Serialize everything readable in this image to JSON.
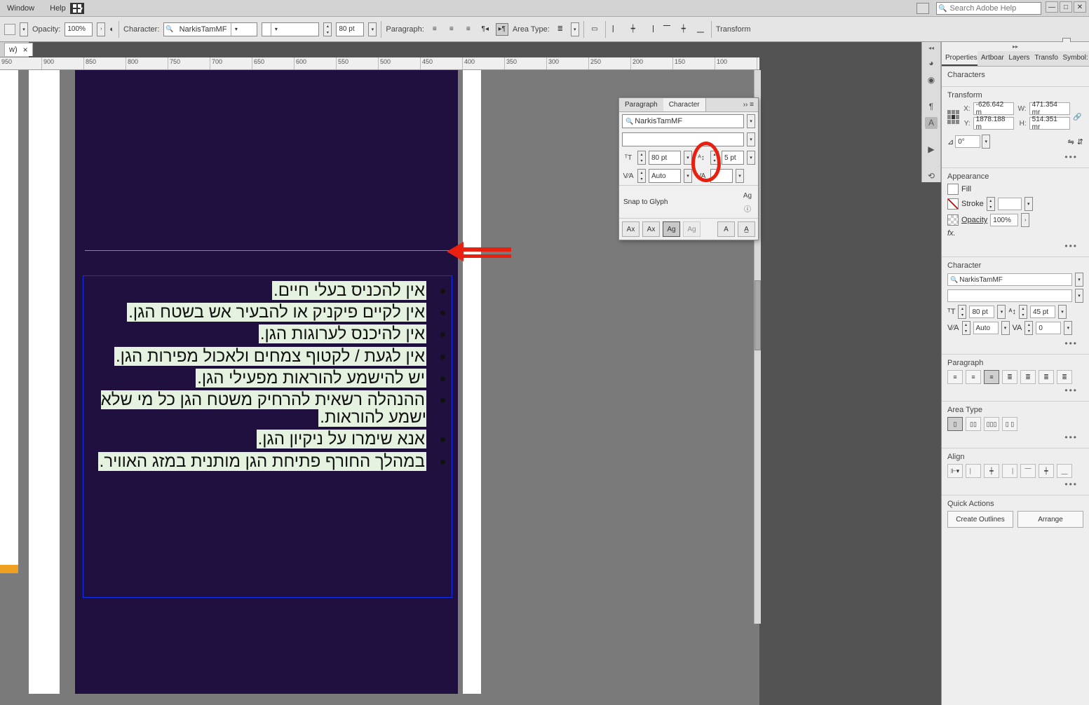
{
  "menubar": {
    "window": "Window",
    "help": "Help"
  },
  "search": {
    "placeholder": "Search Adobe Help"
  },
  "controlbar": {
    "opacity_label": "Opacity:",
    "opacity_val": "100%",
    "character_label": "Character:",
    "font_name": "NarkisTamMF",
    "font_style": "",
    "size_val": "80 pt",
    "paragraph_label": "Paragraph:",
    "area_type_label": "Area Type:",
    "transform_label": "Transform"
  },
  "tab": {
    "name": "w)",
    "close": "×"
  },
  "ruler": [
    "950",
    "900",
    "850",
    "800",
    "750",
    "700",
    "650",
    "600",
    "550",
    "500",
    "450",
    "400",
    "350",
    "300",
    "250",
    "200",
    "150",
    "100"
  ],
  "text_lines": [
    "אין להכניס בעלי חיים.",
    "אין לקיים פיקניק או להבעיר אש בשטח הגן.",
    "אין להיכנס לערוגות הגן.",
    "אין לגעת / לקטוף צמחים ולאכול מפירות הגן.",
    "יש להישמע להוראות מפעילי הגן.",
    "ההנהלה רשאית להרחיק משטח הגן כל מי שלא ישמע להוראות.",
    "אנא שימרו על ניקיון הגן.",
    "במהלך החורף פתיחת הגן מותנית במזג האוויר."
  ],
  "float_panel": {
    "tab_paragraph": "Paragraph",
    "tab_character": "Character",
    "font": "NarkisTamMF",
    "style": "",
    "size": "80 pt",
    "leading": "5 pt",
    "kerning": "Auto",
    "tracking": "",
    "snap": "Snap to Glyph"
  },
  "prop": {
    "tabs": [
      "Properties",
      "Artboar",
      "Layers",
      "Transfo",
      "Symbol:"
    ],
    "section_characters": "Characters",
    "section_transform": "Transform",
    "x": "-626.642 m",
    "y": "1878.188 m",
    "w": "471.354 mr",
    "h": "514.351 mr",
    "angle": "0°",
    "section_appearance": "Appearance",
    "fill": "Fill",
    "stroke": "Stroke",
    "opacity": "Opacity",
    "opacity_val": "100%",
    "fx": "fx.",
    "section_character": "Character",
    "char_font": "NarkisTamMF",
    "char_style": "",
    "char_size": "80 pt",
    "char_leading": "45 pt",
    "char_kern": "Auto",
    "char_track": "0",
    "section_paragraph": "Paragraph",
    "section_areatype": "Area Type",
    "section_align": "Align",
    "section_quick": "Quick Actions",
    "btn_outlines": "Create Outlines",
    "btn_arrange": "Arrange"
  }
}
